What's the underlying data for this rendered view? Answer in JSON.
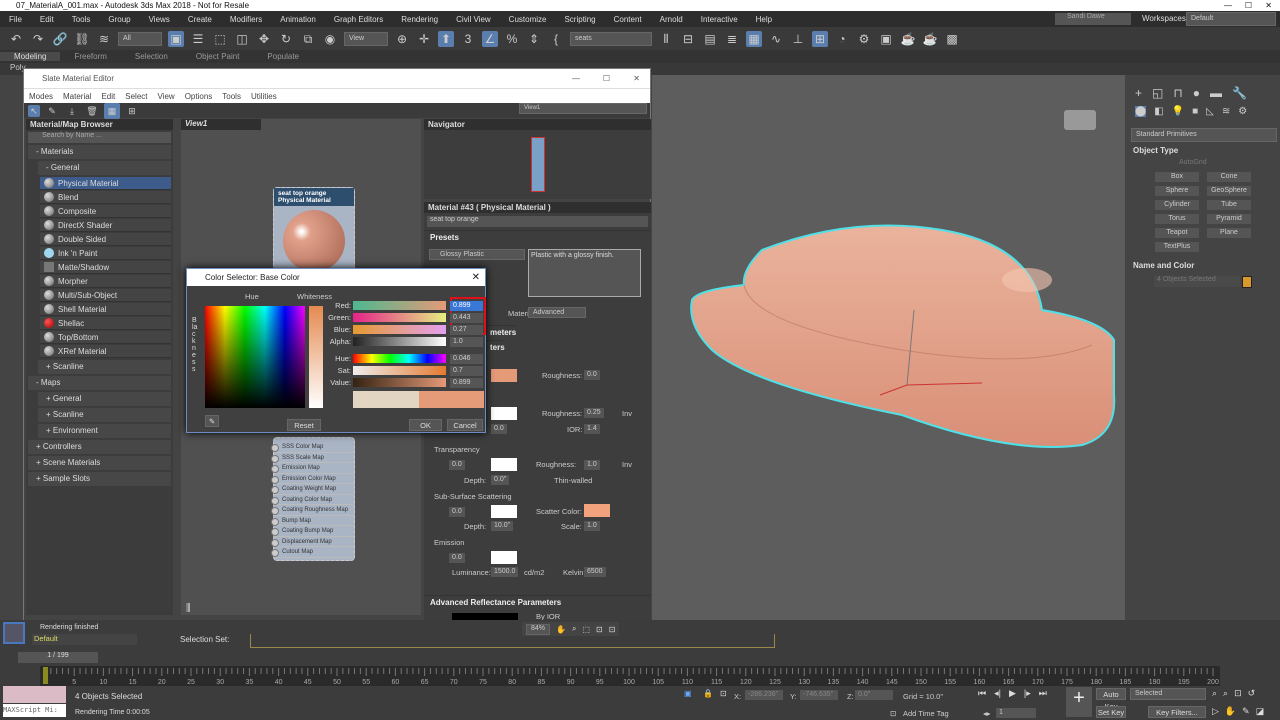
{
  "app": {
    "title": "07_MaterialA_001.max - Autodesk 3ds Max 2018 - Not for Resale",
    "menu": [
      "File",
      "Edit",
      "Tools",
      "Group",
      "Views",
      "Create",
      "Modifiers",
      "Animation",
      "Graph Editors",
      "Rendering",
      "Civil View",
      "Customize",
      "Scripting",
      "Content",
      "Arnold",
      "Interactive",
      "Help"
    ],
    "user": "Sandi Dawe",
    "workspaces_label": "Workspaces:",
    "workspace": "Default",
    "selection_filter": "All",
    "ref_coord": "View",
    "named_sel": "seats",
    "ribbon_tabs": [
      "Modeling",
      "Freeform",
      "Selection",
      "Object Paint",
      "Populate"
    ],
    "poly_label": "Poly"
  },
  "sme": {
    "title": "Slate Material Editor",
    "menu": [
      "Modes",
      "Material",
      "Edit",
      "Select",
      "View",
      "Options",
      "Tools",
      "Utilities"
    ],
    "view_select": "View1",
    "browser": {
      "title": "Material/Map Browser",
      "search_placeholder": "Search by Name ...",
      "materials": "- Materials",
      "general": "- General",
      "items": [
        "Physical Material",
        "Blend",
        "Composite",
        "DirectX Shader",
        "Double Sided",
        "Ink 'n Paint",
        "Matte/Shadow",
        "Morpher",
        "Multi/Sub-Object",
        "Shell Material",
        "Shellac",
        "Top/Bottom",
        "XRef Material"
      ],
      "groups": [
        "+ Scanline",
        "- Maps",
        "+ General",
        "+ Scanline",
        "+ Environment",
        "+ Controllers",
        "+ Scene Materials",
        "+ Sample Slots"
      ]
    },
    "view_tab": "View1",
    "node": {
      "name": "seat top orange",
      "type": "Physical Material",
      "slots": [
        "SSS Color Map",
        "SSS Scale Map",
        "Emission Map",
        "Emission Color Map",
        "Coating Weight Map",
        "Coating Color Map",
        "Coating Roughness Map",
        "Bump Map",
        "Coating Bump Map",
        "Displacement Map",
        "Cutout Map"
      ]
    },
    "navigator": "Navigator",
    "params": {
      "header": "Material #43  ( Physical Material )",
      "name": "seat top orange",
      "presets": "Presets",
      "preset": "Glossy Plastic",
      "preset_desc": "Plastic with a glossy finish.",
      "mode_label": "Material mode:",
      "mode": "Advanced",
      "sec2": "meters",
      "sec3": "ters",
      "base_rough_label": "Roughness:",
      "base_rough": "0.0",
      "refl_rough_label": "Roughness:",
      "refl_rough": "0.25",
      "inv": "Inv",
      "refl_weight": "0.0",
      "ior_label": "IOR:",
      "ior": "1.4",
      "transparency": "Transparency",
      "tr_weight": "0.0",
      "tr_rough_label": "Roughness:",
      "tr_rough": "1.0",
      "tr_depth_label": "Depth:",
      "tr_depth": "0.0\"",
      "thin": "Thin-walled",
      "sss": "Sub-Surface Scattering",
      "sss_weight": "0.0",
      "scatter_label": "Scatter Color:",
      "sss_depth_label": "Depth:",
      "sss_depth": "10.0\"",
      "scale_label": "Scale:",
      "scale": "1.0",
      "emission": "Emission",
      "em_weight": "0.0",
      "lum_label": "Luminance:",
      "lum": "1500.0",
      "lum_unit": "cd/m2",
      "kelvin_label": "Kelvin:",
      "kelvin": "6500",
      "adv": "Advanced Reflectance Parameters",
      "by_ior": "By IOR",
      "zoom": "84%"
    }
  },
  "color_selector": {
    "title": "Color Selector: Base Color",
    "hue_label": "Hue",
    "whiteness_label": "Whiteness",
    "blackness_label": "Blackness",
    "rows": [
      {
        "label": "Red:",
        "value": "0.899"
      },
      {
        "label": "Green:",
        "value": "0.443"
      },
      {
        "label": "Blue:",
        "value": "0.27"
      },
      {
        "label": "Alpha:",
        "value": "1.0"
      },
      {
        "label": "Hue:",
        "value": "0.046"
      },
      {
        "label": "Sat:",
        "value": "0.7"
      },
      {
        "label": "Value:",
        "value": "0.899"
      }
    ],
    "reset": "Reset",
    "ok": "OK",
    "cancel": "Cancel",
    "current_color": "#e59a78",
    "old_color": "#e2d6c2"
  },
  "cmd": {
    "dropdown": "Standard Primitives",
    "object_type": "Object Type",
    "autogrid": "AutoGrid",
    "buttons": [
      "Box",
      "Cone",
      "Sphere",
      "GeoSphere",
      "Cylinder",
      "Tube",
      "Torus",
      "Pyramid",
      "Teapot",
      "Plane",
      "TextPlus"
    ],
    "name_color": "Name and Color",
    "name_field": "4 Objects Selected",
    "obj_color": "#d89a2a"
  },
  "status": {
    "rendering": "Rendering finished",
    "layer": "Default",
    "selset": "Selection Set:",
    "frame": "1 / 199",
    "selected": "4 Objects Selected",
    "rtime": "Rendering Time  0:00:05",
    "maxscript": "MAXScript Mi:",
    "x_label": "X:",
    "x": "-286.236\"",
    "y_label": "Y:",
    "y": "-746.635\"",
    "z_label": "Z:",
    "z": "0.0\"",
    "grid": "Grid = 10.0\"",
    "add_tag": "Add Time Tag",
    "auto_key": "Auto Key",
    "set_key": "Set Key",
    "key_mode": "Selected",
    "key_filters": "Key Filters...",
    "cur_frame": "1"
  },
  "timeline": {
    "start": 0,
    "end": 200,
    "step": 5
  }
}
